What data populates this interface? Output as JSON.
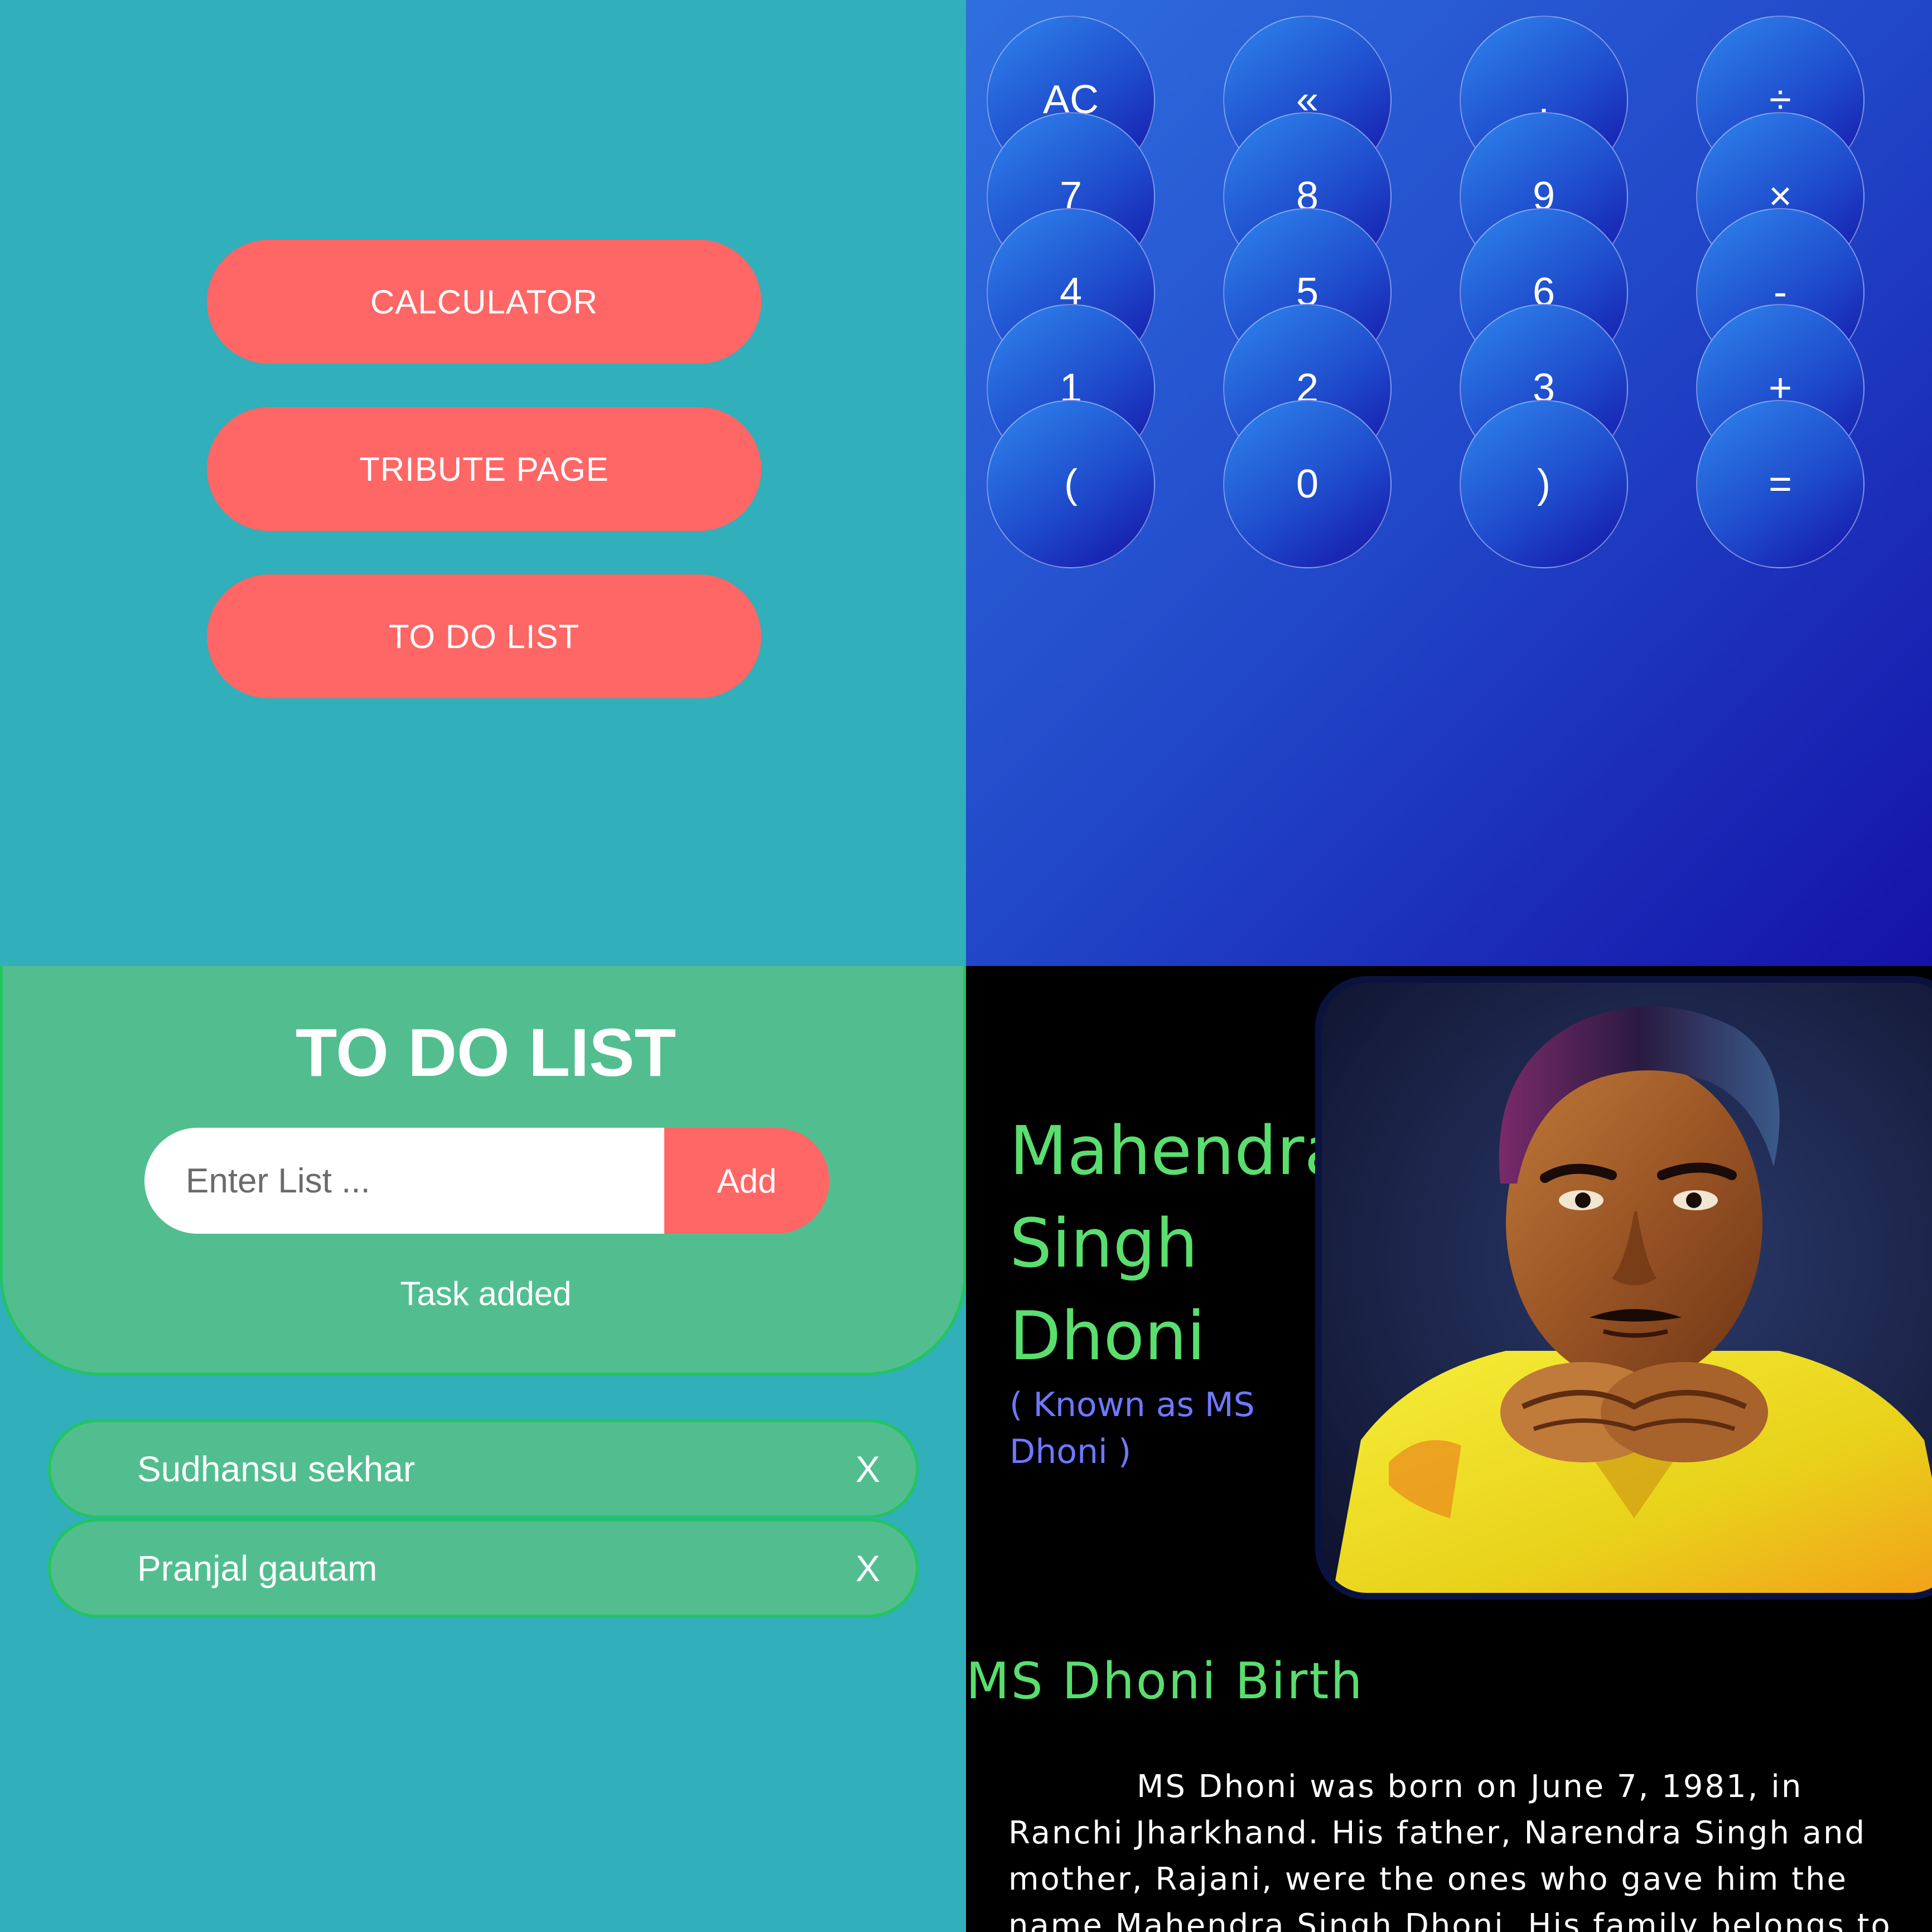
{
  "menu": {
    "buttons": [
      "CALCULATOR",
      "TRIBUTE PAGE",
      "TO DO LIST"
    ],
    "colors": {
      "background": "#31afba",
      "button": "#ff6666"
    }
  },
  "calculator": {
    "keys": [
      "AC",
      "«",
      ".",
      "÷",
      "7",
      "8",
      "9",
      "×",
      "4",
      "5",
      "6",
      "-",
      "1",
      "2",
      "3",
      "+",
      "(",
      "0",
      ")",
      "="
    ],
    "colors": {
      "gradient_start": "#2f6fe0",
      "gradient_end": "#1512a8"
    }
  },
  "todo": {
    "title": "TO DO LIST",
    "input_placeholder": "Enter List ...",
    "add_label": "Add",
    "status": "Task added",
    "tasks": [
      {
        "text": "Sudhansu sekhar",
        "delete_label": "X"
      },
      {
        "text": "Pranjal gautam",
        "delete_label": "X"
      }
    ],
    "colors": {
      "card": "#52be90",
      "border": "#22c55e",
      "accent": "#ff6666"
    }
  },
  "tribute": {
    "name": "Mahendra\nSingh\nDhoni",
    "also_known": "( Known as MS Dhoni )",
    "section_title": "MS Dhoni Birth",
    "paragraph": "MS Dhoni was born on June 7, 1981, in Ranchi Jharkhand. His father, Narendra Singh and mother, Rajani, were the ones who gave him the name Mahendra Singh Dhoni. His family belongs to a",
    "colors": {
      "heading": "#5ade6e",
      "subtitle": "#6f78ff",
      "background": "#000000"
    }
  }
}
